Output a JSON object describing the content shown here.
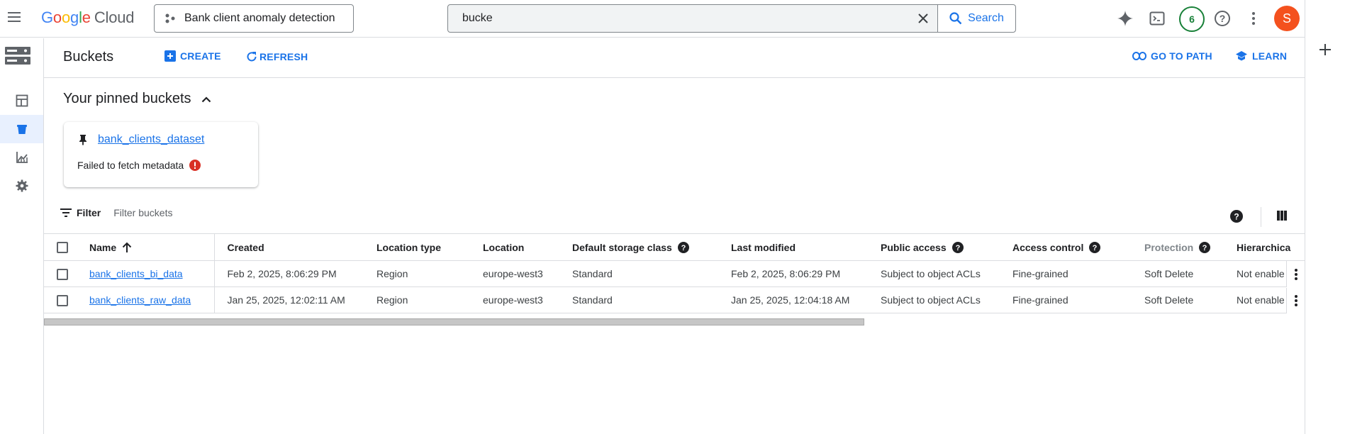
{
  "topbar": {
    "logo": {
      "g1": "G",
      "g2": "o",
      "g3": "o",
      "g4": "g",
      "g5": "l",
      "g6": "e",
      "product": "Cloud"
    },
    "project_name": "Bank client anomaly detection",
    "search": {
      "value": "bucke",
      "button_label": "Search"
    },
    "notification_count": "6",
    "avatar_initial": "S"
  },
  "header": {
    "title": "Buckets",
    "create_label": "CREATE",
    "refresh_label": "REFRESH",
    "go_to_path_label": "GO TO PATH",
    "learn_label": "LEARN"
  },
  "pinned": {
    "title": "Your pinned buckets",
    "bucket_name": "bank_clients_dataset",
    "error_text": "Failed to fetch metadata"
  },
  "filter": {
    "label": "Filter",
    "placeholder": "Filter buckets"
  },
  "table": {
    "columns": [
      "Name",
      "Created",
      "Location type",
      "Location",
      "Default storage class",
      "Last modified",
      "Public access",
      "Access control",
      "Protection",
      "Hierarchica"
    ],
    "rows": [
      {
        "name": "bank_clients_bi_data",
        "created": "Feb 2, 2025, 8:06:29 PM",
        "location_type": "Region",
        "location": "europe-west3",
        "storage_class": "Standard",
        "last_modified": "Feb 2, 2025, 8:06:29 PM",
        "public_access": "Subject to object ACLs",
        "access_control": "Fine-grained",
        "protection": "Soft Delete",
        "hierarchical": "Not enable"
      },
      {
        "name": "bank_clients_raw_data",
        "created": "Jan 25, 2025, 12:02:11 AM",
        "location_type": "Region",
        "location": "europe-west3",
        "storage_class": "Standard",
        "last_modified": "Jan 25, 2025, 12:04:18 AM",
        "public_access": "Subject to object ACLs",
        "access_control": "Fine-grained",
        "protection": "Soft Delete",
        "hierarchical": "Not enable"
      }
    ]
  },
  "colors": {
    "accent": "#1a73e8",
    "error": "#d93025",
    "notification": "#188038",
    "avatar": "#f4511e"
  }
}
